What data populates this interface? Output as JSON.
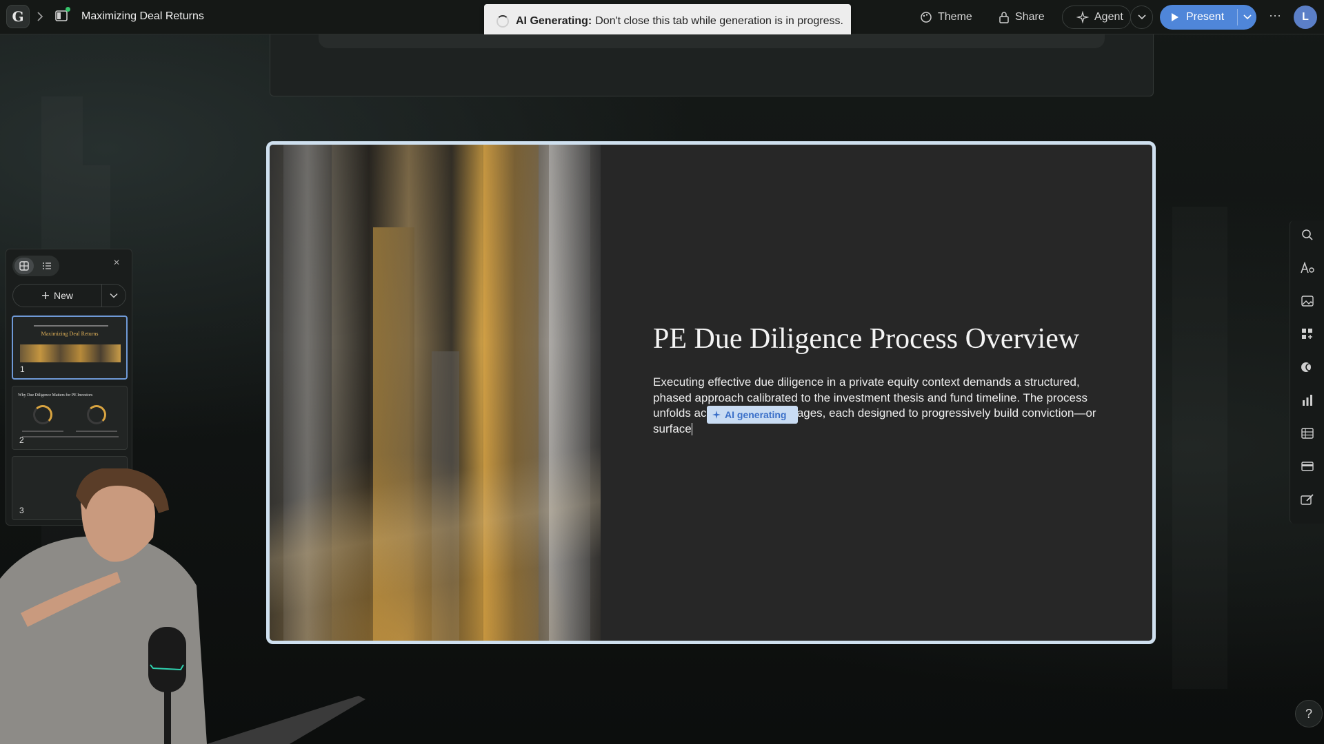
{
  "app": {
    "logo_letter": "G",
    "doc_title": "Maximizing Deal Returns"
  },
  "toast": {
    "bold": "AI Generating:",
    "message": "Don't close this tab while generation is in progress."
  },
  "toolbar": {
    "theme_label": "Theme",
    "share_label": "Share",
    "agent_label": "Agent",
    "present_label": "Present",
    "more_label": "···",
    "avatar_initial": "L"
  },
  "slide": {
    "title": "PE Due Diligence Process Overview",
    "body_before": "Executing effective due diligence in a private equity context demands a structured, phased approach calibrated to the investment thesis and fund timeline. The process unfolds ac",
    "body_gap": "                         ",
    "body_after": "stages, each designed to progressively build conviction—or surface",
    "ai_chip_label": "AI generating"
  },
  "panel": {
    "new_label": "New",
    "close_label": "×",
    "thumbnails": [
      {
        "number": "1",
        "title": "Maximizing Deal Returns"
      },
      {
        "number": "2",
        "title": "Why Due Diligence Matters for PE Investors"
      },
      {
        "number": "3"
      }
    ]
  },
  "help_label": "?",
  "colors": {
    "accent_blue": "#4f86d9",
    "selection_border": "#cfe0ef",
    "gold": "#d9a440"
  }
}
